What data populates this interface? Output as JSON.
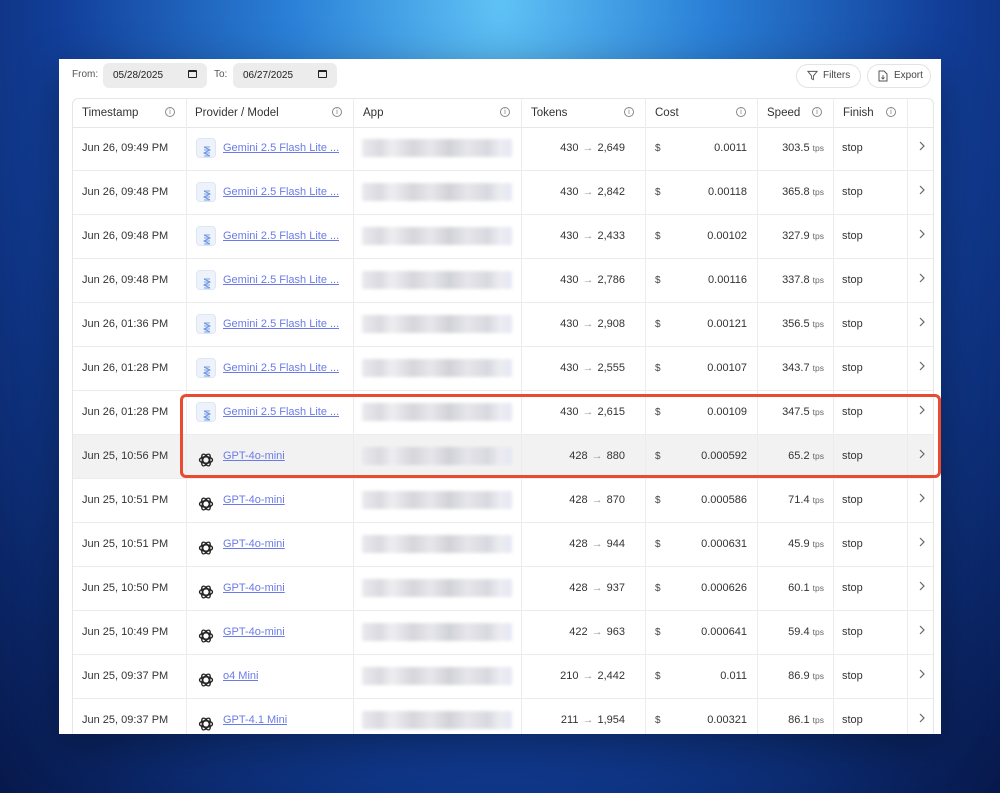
{
  "toolbar": {
    "from_label": "From:",
    "from_value": "05/28/2025",
    "to_label": "To:",
    "to_value": "06/27/2025",
    "filters_label": "Filters",
    "export_label": "Export"
  },
  "columns": [
    "Timestamp",
    "Provider / Model",
    "App",
    "Tokens",
    "Cost",
    "Speed",
    "Finish"
  ],
  "currency_symbol": "$",
  "arrow_symbol": "→",
  "speed_unit": "tps",
  "colors": {
    "highlight": "#e84b2f",
    "link": "#6a7be8"
  },
  "rows": [
    {
      "ts": "Jun 26, 09:49 PM",
      "model": "Gemini 2.5 Flash Lite ...",
      "icon": "gemini-icon",
      "tin": "430",
      "tout": "2,649",
      "cost": "0.0011",
      "speed": "303.5",
      "finish": "stop"
    },
    {
      "ts": "Jun 26, 09:48 PM",
      "model": "Gemini 2.5 Flash Lite ...",
      "icon": "gemini-icon",
      "tin": "430",
      "tout": "2,842",
      "cost": "0.00118",
      "speed": "365.8",
      "finish": "stop"
    },
    {
      "ts": "Jun 26, 09:48 PM",
      "model": "Gemini 2.5 Flash Lite ...",
      "icon": "gemini-icon",
      "tin": "430",
      "tout": "2,433",
      "cost": "0.00102",
      "speed": "327.9",
      "finish": "stop"
    },
    {
      "ts": "Jun 26, 09:48 PM",
      "model": "Gemini 2.5 Flash Lite ...",
      "icon": "gemini-icon",
      "tin": "430",
      "tout": "2,786",
      "cost": "0.00116",
      "speed": "337.8",
      "finish": "stop"
    },
    {
      "ts": "Jun 26, 01:36 PM",
      "model": "Gemini 2.5 Flash Lite ...",
      "icon": "gemini-icon",
      "tin": "430",
      "tout": "2,908",
      "cost": "0.00121",
      "speed": "356.5",
      "finish": "stop"
    },
    {
      "ts": "Jun 26, 01:28 PM",
      "model": "Gemini 2.5 Flash Lite ...",
      "icon": "gemini-icon",
      "tin": "430",
      "tout": "2,555",
      "cost": "0.00107",
      "speed": "343.7",
      "finish": "stop"
    },
    {
      "ts": "Jun 26, 01:28 PM",
      "model": "Gemini 2.5 Flash Lite ...",
      "icon": "gemini-icon",
      "tin": "430",
      "tout": "2,615",
      "cost": "0.00109",
      "speed": "347.5",
      "finish": "stop"
    },
    {
      "ts": "Jun 25, 10:56 PM",
      "model": "GPT-4o-mini",
      "icon": "openai-icon",
      "tin": "428",
      "tout": "880",
      "cost": "0.000592",
      "speed": "65.2",
      "finish": "stop"
    },
    {
      "ts": "Jun 25, 10:51 PM",
      "model": "GPT-4o-mini",
      "icon": "openai-icon",
      "tin": "428",
      "tout": "870",
      "cost": "0.000586",
      "speed": "71.4",
      "finish": "stop"
    },
    {
      "ts": "Jun 25, 10:51 PM",
      "model": "GPT-4o-mini",
      "icon": "openai-icon",
      "tin": "428",
      "tout": "944",
      "cost": "0.000631",
      "speed": "45.9",
      "finish": "stop"
    },
    {
      "ts": "Jun 25, 10:50 PM",
      "model": "GPT-4o-mini",
      "icon": "openai-icon",
      "tin": "428",
      "tout": "937",
      "cost": "0.000626",
      "speed": "60.1",
      "finish": "stop"
    },
    {
      "ts": "Jun 25, 10:49 PM",
      "model": "GPT-4o-mini",
      "icon": "openai-icon",
      "tin": "422",
      "tout": "963",
      "cost": "0.000641",
      "speed": "59.4",
      "finish": "stop"
    },
    {
      "ts": "Jun 25, 09:37 PM",
      "model": "o4 Mini",
      "icon": "openai-icon",
      "tin": "210",
      "tout": "2,442",
      "cost": "0.011",
      "speed": "86.9",
      "finish": "stop"
    },
    {
      "ts": "Jun 25, 09:37 PM",
      "model": "GPT-4.1 Mini",
      "icon": "openai-icon",
      "tin": "211",
      "tout": "1,954",
      "cost": "0.00321",
      "speed": "86.1",
      "finish": "stop"
    }
  ]
}
